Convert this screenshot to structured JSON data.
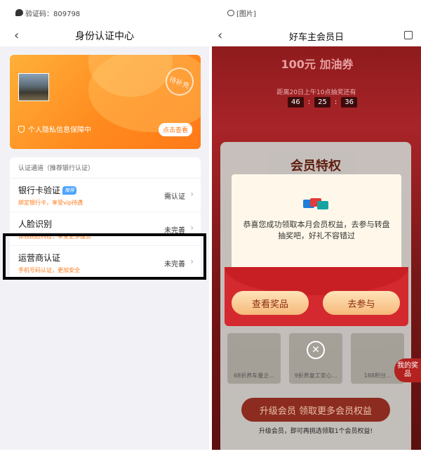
{
  "left": {
    "status": {
      "text": "验证码：809798"
    },
    "nav": {
      "title": "身份认证中心"
    },
    "banner": {
      "stamp": "待补充",
      "privacy": "个人隐私信息保障中",
      "check_button": "点击查看"
    },
    "card": {
      "header": "认证通道（推荐银行认证）",
      "rows": [
        {
          "title": "银行卡验证",
          "tag": "推荐",
          "subtitle": "绑定银行卡，享受vip待遇",
          "status": "需认证"
        },
        {
          "title": "人脸识别",
          "subtitle": "体验刷脸科技，享受更多服务",
          "status": "未完善"
        },
        {
          "title": "运营商认证",
          "subtitle": "手机号码认证，更加安全",
          "status": "未完善"
        }
      ]
    }
  },
  "right": {
    "status": {
      "text": "[图片]"
    },
    "nav": {
      "title": "好车主会员日"
    },
    "bg": {
      "coupon": "100元 加油券",
      "countdown_text": "距离20日上午10点抽奖还有",
      "countdown": [
        "46",
        "25",
        "36"
      ]
    },
    "panel": {
      "title": "会员特权",
      "tiles": [
        "68折养车量企...",
        "9折养复工安心...",
        "188积分..."
      ],
      "upgrade_button": "升级会员 领取更多会员权益",
      "upgrade_sub": "升级会员，即可再挑选领取1个会员权益!"
    },
    "side_tag": "我的奖品",
    "modal": {
      "message": "恭喜您成功领取本月会员权益，去参与转盘抽奖吧，好礼不容错过",
      "view_button": "查看奖品",
      "join_button": "去参与"
    }
  }
}
